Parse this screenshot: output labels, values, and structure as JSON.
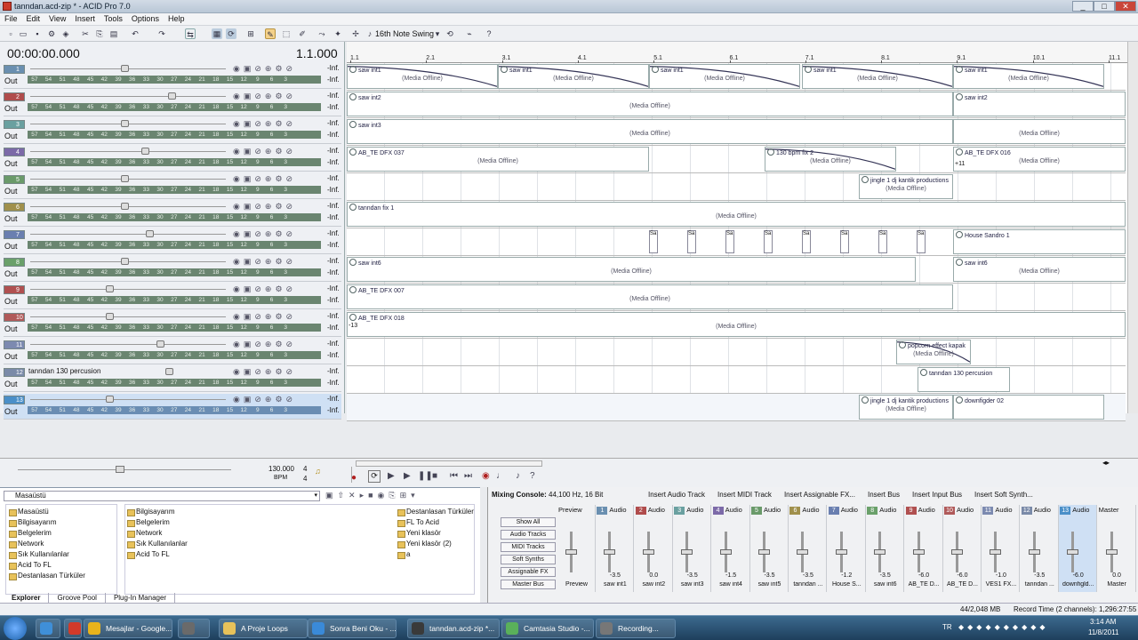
{
  "window": {
    "title": "tanndan.acd-zip * - ACID Pro 7.0"
  },
  "menu": [
    "File",
    "Edit",
    "View",
    "Insert",
    "Tools",
    "Options",
    "Help"
  ],
  "toolbar": {
    "swing": "16th Note Swing"
  },
  "track_header": {
    "time": "00:00:00.000",
    "measure": "1.1.000",
    "out_label": "Out",
    "inf_label": "-Inf.",
    "meter_ticks": [
      "57",
      "54",
      "51",
      "48",
      "45",
      "42",
      "39",
      "36",
      "33",
      "30",
      "27",
      "24",
      "21",
      "18",
      "15",
      "12",
      "9",
      "6",
      "3"
    ],
    "tracks": [
      {
        "num": "1",
        "color": "#6a8fb0",
        "name": ""
      },
      {
        "num": "2",
        "color": "#b04c4c",
        "name": ""
      },
      {
        "num": "3",
        "color": "#6aa0a0",
        "name": ""
      },
      {
        "num": "4",
        "color": "#7c6aa8",
        "name": ""
      },
      {
        "num": "5",
        "color": "#6a9a6a",
        "name": ""
      },
      {
        "num": "6",
        "color": "#a0904c",
        "name": ""
      },
      {
        "num": "7",
        "color": "#6a7fb0",
        "name": ""
      },
      {
        "num": "8",
        "color": "#6aa06a",
        "name": ""
      },
      {
        "num": "9",
        "color": "#b05050",
        "name": ""
      },
      {
        "num": "10",
        "color": "#b05a5a",
        "name": ""
      },
      {
        "num": "11",
        "color": "#7c8ab0",
        "name": ""
      },
      {
        "num": "12",
        "color": "#7a8aa8",
        "name": "tanndan 130 percusion"
      },
      {
        "num": "13",
        "color": "#4a8fc8",
        "name": ""
      }
    ],
    "tempo": "130.000",
    "bpm_label": "BPM",
    "sig_top": "4",
    "sig_bottom": "4"
  },
  "ruler": [
    "1.1",
    "2.1",
    "3.1",
    "4.1",
    "5.1",
    "6.1",
    "7.1",
    "8.1",
    "9.1",
    "10.1",
    "11.1"
  ],
  "lanes": [
    [
      {
        "label": "saw int1",
        "off": "(Media Offline)"
      },
      {
        "label": "saw int1",
        "off": "(Media Offline)"
      },
      {
        "label": "saw int1",
        "off": "(Media Offline)"
      },
      {
        "label": "saw int1",
        "off": "(Media Offline)"
      },
      {
        "label": "saw int1",
        "off": "(Media Offline)"
      }
    ],
    [
      {
        "label": "saw int2",
        "off": "(Media Offline)"
      },
      {
        "label": "saw int2",
        "off": ""
      }
    ],
    [
      {
        "label": "saw int3",
        "off": "(Media Offline)"
      },
      {
        "label": "",
        "off": "(Media Offline)"
      }
    ],
    [
      {
        "label": "AB_TE DFX 037",
        "off": "(Media Offline)"
      },
      {
        "label": "130 bpm fix 2",
        "off": "(Media Offline)"
      },
      {
        "label": "AB_TE DFX 016",
        "off": "(Media Offline)"
      }
    ],
    [
      {
        "label": "jingle 1 dj kantik productions",
        "off": "(Media Offline)"
      }
    ],
    [
      {
        "label": "tanndan fix 1",
        "off": "(Media Offline)"
      }
    ],
    [
      {
        "label": "House Sandro 1",
        "off": ""
      }
    ],
    [
      {
        "label": "saw int6",
        "off": "(Media Offline)"
      },
      {
        "label": "saw int6",
        "off": "(Media Offline)"
      }
    ],
    [
      {
        "label": "AB_TE DFX 007",
        "off": "(Media Offline)"
      }
    ],
    [
      {
        "label": "AB_TE DFX 018",
        "off": "(Media Offline)"
      }
    ],
    [
      {
        "label": "popcorn effect kapak",
        "off": "(Media Offline)"
      }
    ],
    [
      {
        "label": "tanndan 130 percusion",
        "off": ""
      }
    ],
    [
      {
        "label": "jingle 1 dj kantik productions",
        "off": "(Media Offline)"
      },
      {
        "label": "downfigder 02",
        "off": ""
      }
    ]
  ],
  "lane_extra": {
    "plus11": "+11",
    "minus13": "-13",
    "sample_tag": "Sa"
  },
  "explorer": {
    "location": "Masaüstü",
    "tree": [
      "Masaüstü",
      "Bilgisayarım",
      "Belgelerim",
      "Network",
      "Sık Kullanılanlar",
      "Acid To FL",
      "Destanlasan Türküler"
    ],
    "list1": [
      "Bilgisayarım",
      "Belgelerim",
      "Network",
      "Sık Kullanılanlar",
      "Acid To FL"
    ],
    "list2": [
      "Destanlasan Türküler",
      "FL To Acid",
      "Yeni klasör",
      "Yeni klasör (2)",
      "a"
    ],
    "tabs": [
      "Explorer",
      "Groove Pool",
      "Plug-In Manager"
    ]
  },
  "mixer": {
    "title": "Mixing Console:",
    "format": "44,100 Hz, 16 Bit",
    "actions": [
      "Insert Audio Track",
      "Insert MIDI Track",
      "Insert Assignable FX...",
      "Insert Bus",
      "Insert Input Bus",
      "Insert Soft Synth..."
    ],
    "filters": [
      "Show All",
      "Audio Tracks",
      "MIDI Tracks",
      "Soft Synths",
      "Assignable FX",
      "Master Bus"
    ],
    "channels": [
      {
        "num": "",
        "head": "Preview",
        "foot": "Preview",
        "db": "",
        "color": "#777"
      },
      {
        "num": "1",
        "head": "Audio",
        "foot": "saw int1",
        "db": "-3.5",
        "color": "#6a8fb0"
      },
      {
        "num": "2",
        "head": "Audio",
        "foot": "saw int2",
        "db": "0.0",
        "color": "#b04c4c"
      },
      {
        "num": "3",
        "head": "Audio",
        "foot": "saw int3",
        "db": "-3.5",
        "color": "#6aa0a0"
      },
      {
        "num": "4",
        "head": "Audio",
        "foot": "saw int4",
        "db": "-1.5",
        "color": "#7c6aa8"
      },
      {
        "num": "5",
        "head": "Audio",
        "foot": "saw int5",
        "db": "-3.5",
        "color": "#6a9a6a"
      },
      {
        "num": "6",
        "head": "Audio",
        "foot": "tanndan ...",
        "db": "-3.5",
        "color": "#a0904c"
      },
      {
        "num": "7",
        "head": "Audio",
        "foot": "House S...",
        "db": "-1.2",
        "color": "#6a7fb0"
      },
      {
        "num": "8",
        "head": "Audio",
        "foot": "saw int6",
        "db": "-3.5",
        "color": "#6aa06a"
      },
      {
        "num": "9",
        "head": "Audio",
        "foot": "AB_TE D...",
        "db": "-6.0",
        "color": "#b05050"
      },
      {
        "num": "10",
        "head": "Audio",
        "foot": "AB_TE D...",
        "db": "-6.0",
        "color": "#b05a5a"
      },
      {
        "num": "11",
        "head": "Audio",
        "foot": "VES1 FX...",
        "db": "-1.0",
        "color": "#7c8ab0"
      },
      {
        "num": "12",
        "head": "Audio",
        "foot": "tanndan ...",
        "db": "-3.5",
        "color": "#7a8aa8"
      },
      {
        "num": "13",
        "head": "Audio",
        "foot": "downfigld...",
        "db": "-6.0",
        "color": "#4a8fc8"
      },
      {
        "num": "",
        "head": "Master",
        "foot": "Master",
        "db": "0.0",
        "color": "#777"
      }
    ]
  },
  "status": {
    "mem": "44/2,048 MB",
    "record": "Record Time (2 channels): 1,296:27:55"
  },
  "taskbar": {
    "items": [
      {
        "label": "",
        "color": "#3f8fd8"
      },
      {
        "label": "",
        "color": "#d23a2a"
      },
      {
        "label": "Mesajlar - Google...",
        "color": "#e8b31c"
      },
      {
        "label": "",
        "color": "#6a6a6a"
      },
      {
        "label": "A Proje Loops",
        "color": "#e8c25a"
      },
      {
        "label": "Sonra Beni Oku - ...",
        "color": "#3a8ad8"
      },
      {
        "label": "tanndan.acd-zip *...",
        "color": "#3a3a3a"
      },
      {
        "label": "Camtasia Studio -...",
        "color": "#5ab05a"
      },
      {
        "label": "Recording...",
        "color": "#777"
      }
    ],
    "lang": "TR",
    "clock_time": "3:14 AM",
    "clock_date": "11/8/2011"
  }
}
